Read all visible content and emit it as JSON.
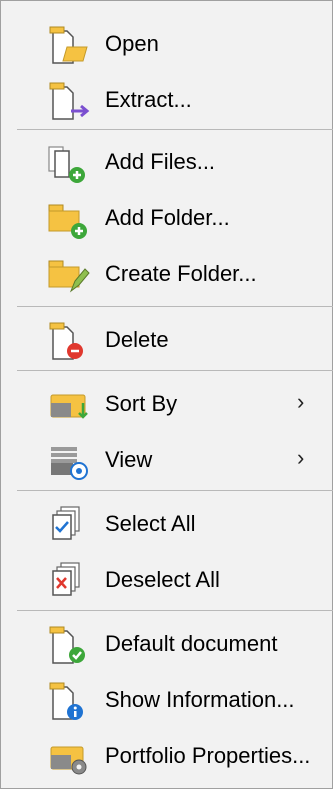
{
  "menu": {
    "items": [
      {
        "label": "Open",
        "icon": "open-folder-icon"
      },
      {
        "label": "Extract...",
        "icon": "extract-icon"
      },
      {
        "label": "Add Files...",
        "icon": "add-files-icon"
      },
      {
        "label": "Add Folder...",
        "icon": "add-folder-icon"
      },
      {
        "label": "Create Folder...",
        "icon": "create-folder-icon"
      },
      {
        "label": "Delete",
        "icon": "delete-icon"
      },
      {
        "label": "Sort By",
        "icon": "sort-by-icon",
        "submenu": true
      },
      {
        "label": "View",
        "icon": "view-icon",
        "submenu": true
      },
      {
        "label": "Select All",
        "icon": "select-all-icon"
      },
      {
        "label": "Deselect All",
        "icon": "deselect-all-icon"
      },
      {
        "label": "Default document",
        "icon": "default-document-icon"
      },
      {
        "label": "Show Information...",
        "icon": "show-information-icon"
      },
      {
        "label": "Portfolio Properties...",
        "icon": "portfolio-properties-icon"
      }
    ],
    "submenu_arrow": "›"
  },
  "colors": {
    "background": "#f2f2f2",
    "separator": "#b9b9b9",
    "folder": "#f5c242",
    "green_plus": "#3da73a",
    "red_minus": "#e0382e",
    "purple_arrow": "#7b4fd0",
    "blue_info": "#1f73d2"
  }
}
